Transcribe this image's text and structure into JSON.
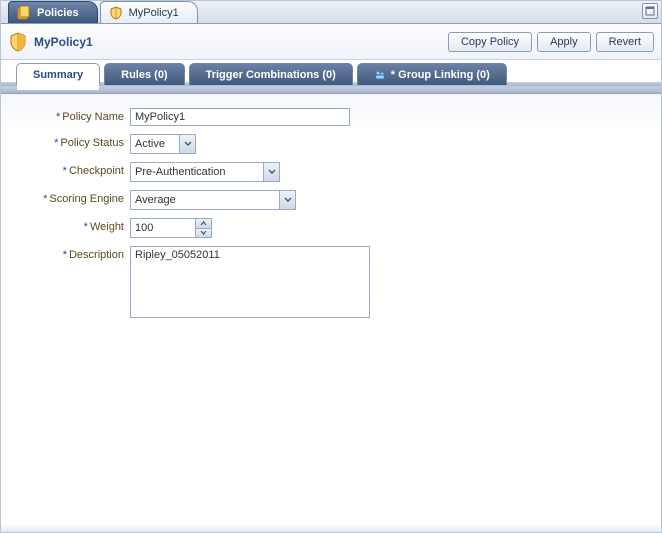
{
  "nav": {
    "tabs": [
      {
        "label": "Policies",
        "active": true
      },
      {
        "label": "MyPolicy1",
        "active": false
      }
    ]
  },
  "header": {
    "title": "MyPolicy1",
    "buttons": {
      "copy": "Copy Policy",
      "apply": "Apply",
      "revert": "Revert"
    }
  },
  "subtabs": {
    "summary": "Summary",
    "rules": "Rules (0)",
    "trigger_combos": "Trigger Combinations (0)",
    "group_linking": "* Group Linking (0)"
  },
  "form": {
    "labels": {
      "policy_name": "Policy Name",
      "policy_status": "Policy Status",
      "checkpoint": "Checkpoint",
      "scoring_engine": "Scoring Engine",
      "weight": "Weight",
      "description": "Description"
    },
    "values": {
      "policy_name": "MyPolicy1",
      "policy_status": "Active",
      "checkpoint": "Pre-Authentication",
      "scoring_engine": "Average",
      "weight": "100",
      "description": "Ripley_05052011"
    },
    "required_marker": "*"
  }
}
